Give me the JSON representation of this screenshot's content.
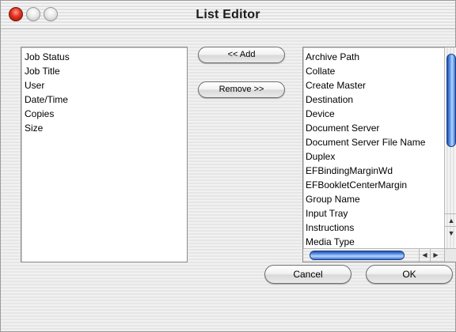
{
  "window": {
    "title": "List Editor"
  },
  "left_list": {
    "items": [
      "Job Status",
      "Job Title",
      "User",
      "Date/Time",
      "Copies",
      "Size"
    ]
  },
  "buttons": {
    "add_label": "<< Add",
    "remove_label": "Remove >>",
    "cancel_label": "Cancel",
    "ok_label": "OK"
  },
  "right_list": {
    "items": [
      "Archive Path",
      "Collate",
      "Create Master",
      "Destination",
      "Device",
      "Document Server",
      "Document Server File Name",
      "Duplex",
      "EFBindingMarginWd",
      "EFBookletCenterMargin",
      "Group Name",
      "Input Tray",
      "Instructions",
      "Media Type"
    ]
  },
  "icons": {
    "close": "close-icon",
    "minimize": "minimize-icon",
    "zoom": "zoom-icon",
    "scroll_up": "arrow-up-icon",
    "scroll_down": "arrow-down-icon",
    "scroll_left": "arrow-left-icon",
    "scroll_right": "arrow-right-icon"
  },
  "colors": {
    "close_button": "#e0301e",
    "scroll_thumb": "#3a72d2"
  }
}
